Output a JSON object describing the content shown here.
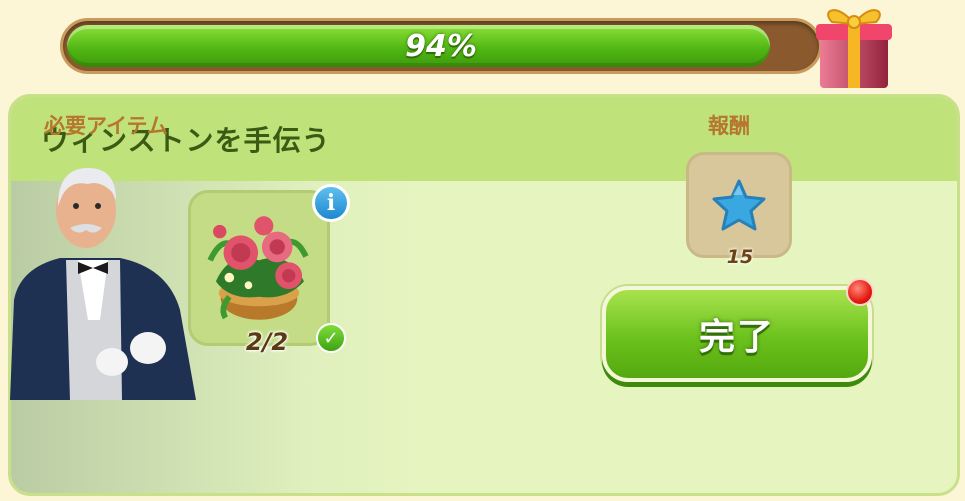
{
  "progress": {
    "label": "94%",
    "value": 0.94
  },
  "task": {
    "title": "ウィンストンを手伝う",
    "required_label": "必要アイテム",
    "reward_label": "報酬",
    "item": {
      "icon": "peony-flower-pot-icon",
      "count": "2/2",
      "completed": true
    },
    "reward": {
      "icon": "blue-star-icon",
      "amount": "15"
    },
    "complete_button": "完了"
  },
  "colors": {
    "progress_fill": "#52b814",
    "button": "#6cc21c",
    "reward_star": "#3aa8e0",
    "notification": "#e41b12"
  }
}
